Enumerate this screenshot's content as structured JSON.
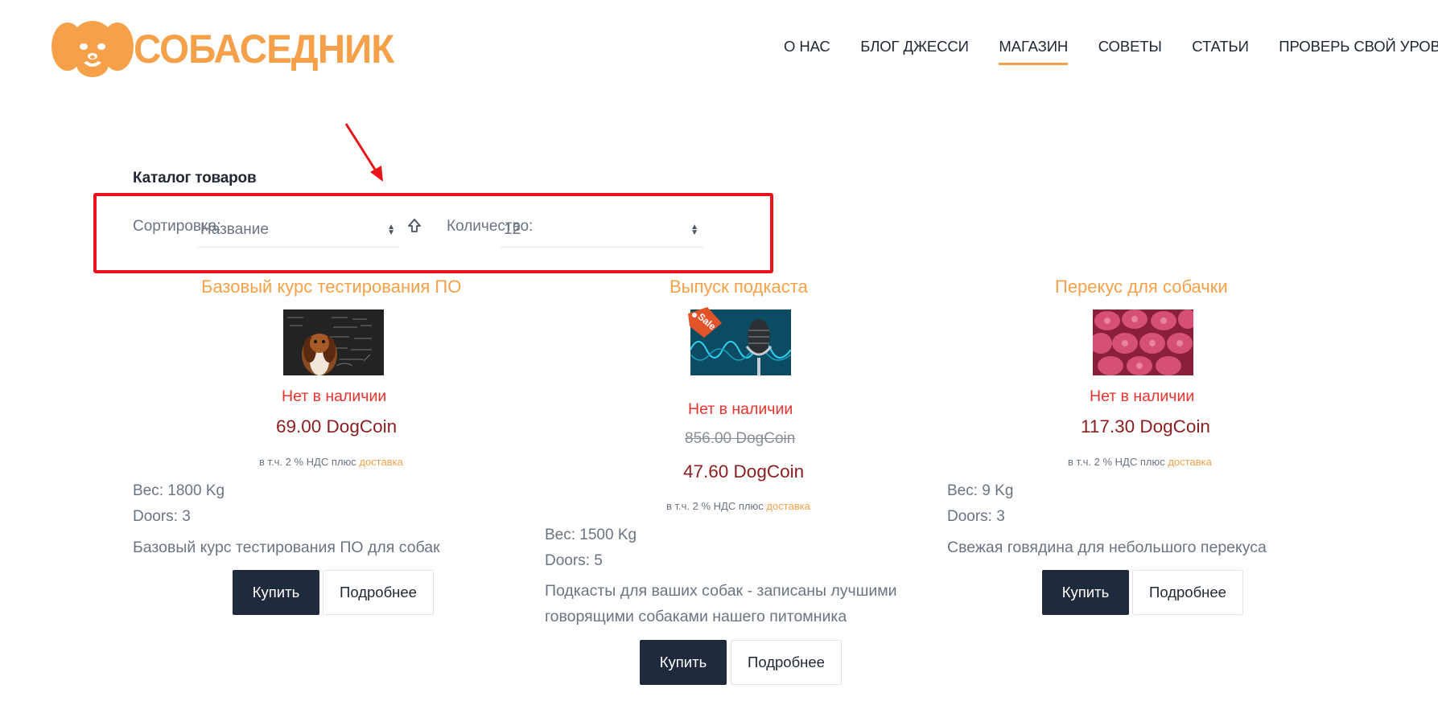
{
  "header": {
    "logo_text": "СОБАСЕДНИК",
    "nav": [
      {
        "label": "О НАС"
      },
      {
        "label": "БЛОГ ДЖЕССИ"
      },
      {
        "label": "МАГАЗИН",
        "active": true
      },
      {
        "label": "СОВЕТЫ"
      },
      {
        "label": "СТАТЬИ"
      },
      {
        "label": "ПРОВЕРЬ СВОЙ УРОВЕНЬ"
      }
    ]
  },
  "catalog": {
    "title": "Каталог товаров",
    "sort_label": "Сортировка:",
    "sort_value": "Название",
    "count_label": "Количество:",
    "count_value": "12"
  },
  "products": [
    {
      "title": "Базовый курс тестирования ПО",
      "image": "beagle-chalkboard-image",
      "stock": "Нет в наличии",
      "price": "69.00 DogCoin",
      "vat_text": "в т.ч. 2 % НДС плюс",
      "vat_link": "доставка",
      "weight": "Вес: 1800 Kg",
      "doors": "Doors: 3",
      "description": "Базовый курс тестирования ПО для собак",
      "buy_label": "Купить",
      "more_label": "Подробнее"
    },
    {
      "title": "Выпуск подкаста",
      "image": "microphone-image",
      "sale_badge": "Sale",
      "stock": "Нет в наличии",
      "old_price": "856.00 DogCoin",
      "price": "47.60 DogCoin",
      "vat_text": "в т.ч. 2 % НДС плюс",
      "vat_link": "доставка",
      "weight": "Вес: 1500 Kg",
      "doors": "Doors: 5",
      "description": "Подкасты для ваших собак - записаны лучшими говорящими собаками нашего питомника",
      "buy_label": "Купить",
      "more_label": "Подробнее"
    },
    {
      "title": "Перекус для собачки",
      "image": "raw-beef-image",
      "stock": "Нет в наличии",
      "price": "117.30 DogCoin",
      "vat_text": "в т.ч. 2 % НДС плюс",
      "vat_link": "доставка",
      "weight": "Вес: 9 Kg",
      "doors": "Doors: 3",
      "description": "Свежая говядина для небольшого перекуса",
      "buy_label": "Купить",
      "more_label": "Подробнее"
    }
  ],
  "colors": {
    "brand_orange": "#f6a04a",
    "nav_text": "#1f2733",
    "stock_red": "#e8342c",
    "price_red": "#8a1d1f",
    "buy_button": "#1f2a3d",
    "annotation_red": "#e8141a"
  }
}
